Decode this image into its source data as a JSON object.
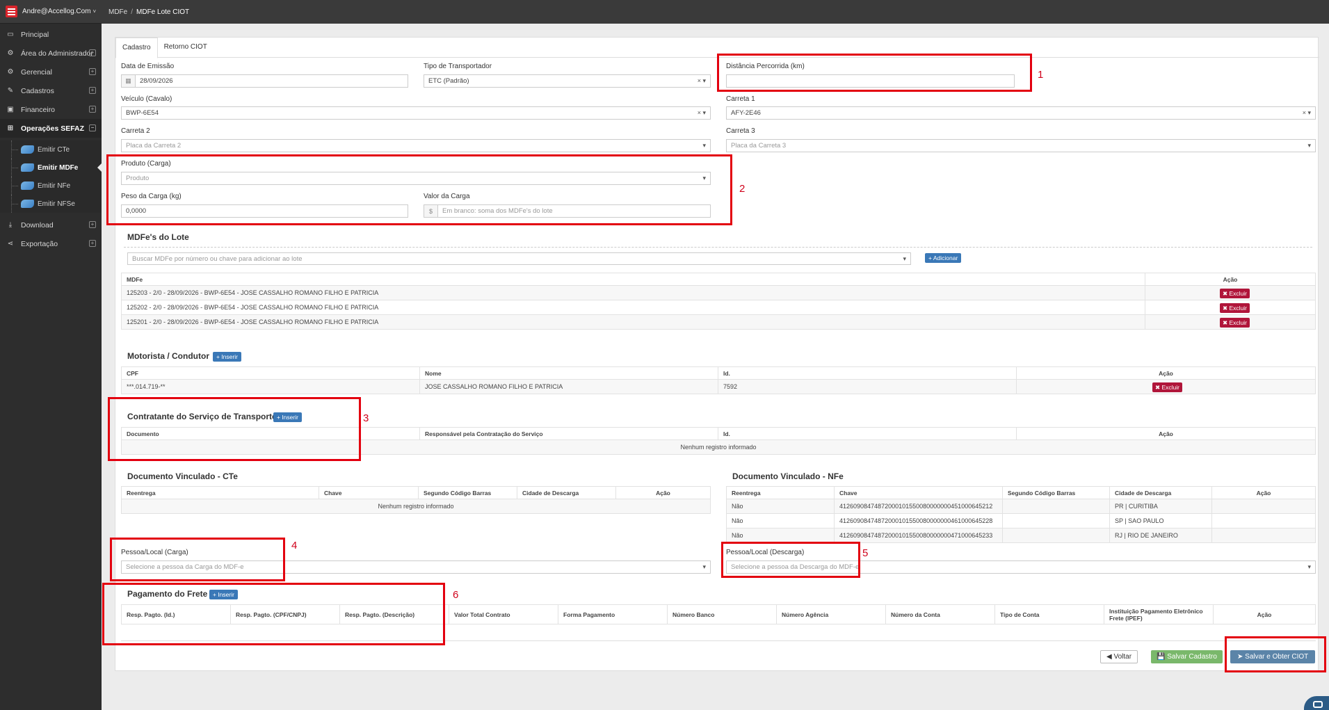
{
  "user": {
    "email": "Andre@Accellog.Com",
    "caret": "˅"
  },
  "sidebar": {
    "items": [
      {
        "label": "Principal",
        "icon": "monitor-icon"
      },
      {
        "label": "Área do Administrador",
        "icon": "gears-icon"
      },
      {
        "label": "Gerencial",
        "icon": "gears-icon"
      },
      {
        "label": "Cadastros",
        "icon": "edit-icon"
      },
      {
        "label": "Financeiro",
        "icon": "money-icon"
      },
      {
        "label": "Operações SEFAZ",
        "icon": "windows-icon"
      },
      {
        "label": "Download",
        "icon": "download-icon"
      },
      {
        "label": "Exportação",
        "icon": "share-icon"
      }
    ],
    "subitems": [
      "Emitir CTe",
      "Emitir MDFe",
      "Emitir NFe",
      "Emitir NFSe"
    ]
  },
  "breadcrumb": {
    "parent": "MDFe",
    "sep": "/",
    "current": "MDFe Lote CIOT"
  },
  "tabs": [
    "Cadastro",
    "Retorno CIOT"
  ],
  "form": {
    "data_emissao_label": "Data de Emissão",
    "data_emissao_value": "28/09/2026",
    "tipo_transportador_label": "Tipo de Transportador",
    "tipo_transportador_value": "ETC (Padrão)",
    "distancia_label": "Distância Percorrida (km)",
    "veiculo_label": "Veículo (Cavalo)",
    "veiculo_value": "BWP-6E54",
    "carreta1_label": "Carreta 1",
    "carreta1_value": "AFY-2E46",
    "carreta2_label": "Carreta 2",
    "carreta2_placeholder": "Placa da Carreta 2",
    "carreta3_label": "Carreta 3",
    "carreta3_placeholder": "Placa da Carreta 3",
    "produto_label": "Produto (Carga)",
    "produto_placeholder": "Produto",
    "peso_label": "Peso da Carga (kg)",
    "peso_value": "0,0000",
    "valor_label": "Valor da Carga",
    "valor_currency": "$",
    "valor_placeholder": "Em branco: soma dos MDFe's do lote",
    "clear_symbol": "×",
    "dropdown_symbol": "▾"
  },
  "mdfes": {
    "title": "MDFe's do Lote",
    "search_placeholder": "Buscar MDFe por número ou chave para adicionar ao lote",
    "add_label": "+ Adicionar",
    "col_mdfe": "MDFe",
    "col_acao": "Ação",
    "rows": [
      "125203 - 2/0 - 28/09/2026 - BWP-6E54 - JOSE CASSALHO ROMANO FILHO E PATRICIA",
      "125202 - 2/0 - 28/09/2026 - BWP-6E54 - JOSE CASSALHO ROMANO FILHO E PATRICIA",
      "125201 - 2/0 - 28/09/2026 - BWP-6E54 - JOSE CASSALHO ROMANO FILHO E PATRICIA"
    ],
    "delete_label": "✖ Excluir"
  },
  "motorista": {
    "title": "Motorista / Condutor",
    "insert_label": "+ Inserir",
    "cols": [
      "CPF",
      "Nome",
      "Id.",
      "Ação"
    ],
    "row": {
      "cpf": "***.014.719-**",
      "nome": "JOSE CASSALHO ROMANO FILHO E PATRICIA",
      "id": "7592"
    },
    "delete_label": "✖ Excluir"
  },
  "contratante": {
    "title": "Contratante do Serviço de Transporte",
    "insert_label": "+ Inserir",
    "cols": [
      "Documento",
      "Responsável pela Contratação do Serviço",
      "Id.",
      "Ação"
    ],
    "empty": "Nenhum registro informado"
  },
  "doc_cte": {
    "title": "Documento Vinculado - CTe",
    "cols": [
      "Reentrega",
      "Chave",
      "Segundo Código Barras",
      "Cidade de Descarga",
      "Ação"
    ],
    "empty": "Nenhum registro informado"
  },
  "doc_nfe": {
    "title": "Documento Vinculado - NFe",
    "cols": [
      "Reentrega",
      "Chave",
      "Segundo Código Barras",
      "Cidade de Descarga",
      "Ação"
    ],
    "rows": [
      {
        "reentrega": "Não",
        "chave": "41260908474872000101550080000000451000645212",
        "segundo": "",
        "cidade": "PR | CURITIBA"
      },
      {
        "reentrega": "Não",
        "chave": "41260908474872000101550080000000461000645228",
        "segundo": "",
        "cidade": "SP | SAO PAULO"
      },
      {
        "reentrega": "Não",
        "chave": "41260908474872000101550080000000471000645233",
        "segundo": "",
        "cidade": "RJ | RIO DE JANEIRO"
      }
    ]
  },
  "pessoa_carga": {
    "label": "Pessoa/Local (Carga)",
    "placeholder": "Selecione a pessoa da Carga do MDF-e"
  },
  "pessoa_descarga": {
    "label": "Pessoa/Local (Descarga)",
    "placeholder": "Selecione a pessoa da Descarga do MDF-e"
  },
  "pagamento": {
    "title": "Pagamento do Frete",
    "insert_label": "+ Inserir",
    "cols": [
      "Resp. Pagto. (Id.)",
      "Resp. Pagto. (CPF/CNPJ)",
      "Resp. Pagto. (Descrição)",
      "Valor Total Contrato",
      "Forma Pagamento",
      "Número Banco",
      "Número Agência",
      "Número da Conta",
      "Tipo de Conta",
      "Instituição Pagamento Eletrônico Frete (IPEF)",
      "Ação"
    ]
  },
  "footer": {
    "voltar": "◀ Voltar",
    "salvar": "💾 Salvar Cadastro",
    "salvar_ciot": "➤ Salvar e Obter CIOT"
  },
  "annotations": [
    "1",
    "2",
    "3",
    "4",
    "5",
    "6"
  ],
  "colors": {
    "annotation": "#e3000f",
    "primary": "#3a78b7",
    "danger": "#b0153a",
    "success": "#7ab86b",
    "sidebar": "#2d2d2d"
  }
}
